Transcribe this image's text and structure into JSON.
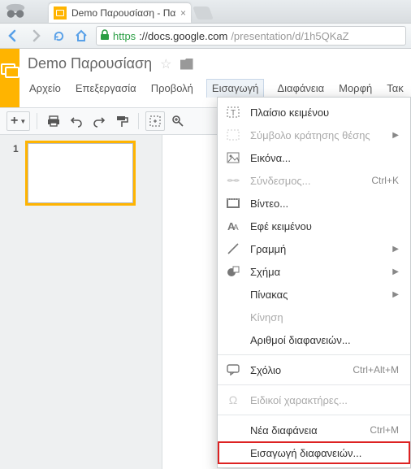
{
  "browser": {
    "tab_title": "Demo Παρουσίαση - Πα",
    "url_https": "https",
    "url_host": "://docs.google.com",
    "url_path": "/presentation/d/1h5QKaZ"
  },
  "app": {
    "title": "Demo Παρουσίαση",
    "menus": [
      "Αρχείο",
      "Επεξεργασία",
      "Προβολή",
      "Εισαγωγή",
      "Διαφάνεια",
      "Μορφή",
      "Τακ"
    ],
    "active_menu_index": 3
  },
  "slides": {
    "thumb_number": "1"
  },
  "menu": {
    "items": [
      {
        "icon": "textbox",
        "label": "Πλαίσιο κειμένου",
        "enabled": true
      },
      {
        "icon": "placeholder",
        "label": "Σύμβολο κράτησης θέσης",
        "enabled": false,
        "sub": true
      },
      {
        "icon": "image",
        "label": "Εικόνα...",
        "enabled": true
      },
      {
        "icon": "link",
        "label": "Σύνδεσμος...",
        "enabled": false,
        "shortcut": "Ctrl+K"
      },
      {
        "icon": "video",
        "label": "Βίντεο...",
        "enabled": true
      },
      {
        "icon": "wordart",
        "label": "Εφέ κειμένου",
        "enabled": true
      },
      {
        "icon": "line",
        "label": "Γραμμή",
        "enabled": true,
        "sub": true
      },
      {
        "icon": "shape",
        "label": "Σχήμα",
        "enabled": true,
        "sub": true
      },
      {
        "icon": "",
        "label": "Πίνακας",
        "enabled": true,
        "sub": true
      },
      {
        "icon": "",
        "label": "Κίνηση",
        "enabled": false
      },
      {
        "icon": "",
        "label": "Αριθμοί διαφανειών...",
        "enabled": true
      },
      {
        "sep": true
      },
      {
        "icon": "comment",
        "label": "Σχόλιο",
        "enabled": true,
        "shortcut": "Ctrl+Alt+M"
      },
      {
        "sep": true
      },
      {
        "icon": "omega",
        "label": "Ειδικοί χαρακτήρες...",
        "enabled": false
      },
      {
        "sep": true
      },
      {
        "icon": "",
        "label": "Νέα διαφάνεια",
        "enabled": true,
        "shortcut": "Ctrl+M"
      },
      {
        "icon": "",
        "label": "Εισαγωγή διαφανειών...",
        "enabled": true,
        "highlight": true
      }
    ]
  }
}
